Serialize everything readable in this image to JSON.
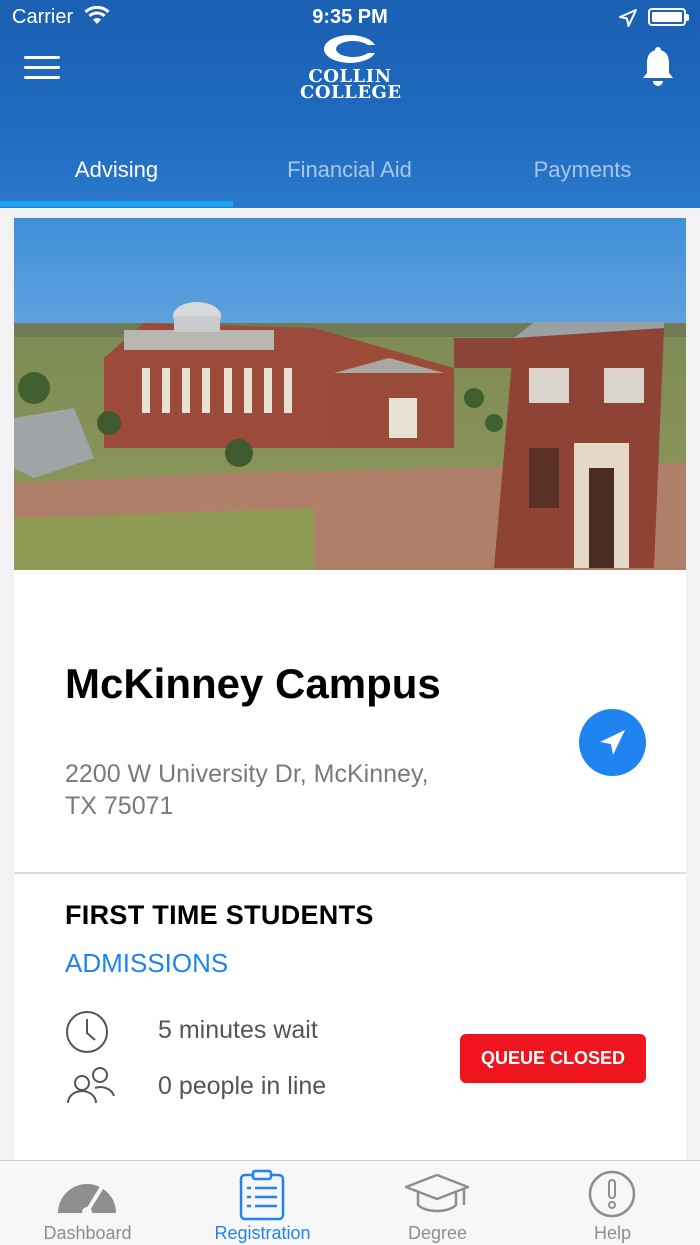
{
  "status_bar": {
    "carrier": "Carrier",
    "time": "9:35 PM"
  },
  "header": {
    "logo_line1": "COLLIN",
    "logo_line2": "COLLEGE",
    "tabs": [
      {
        "label": "Advising",
        "active": true
      },
      {
        "label": "Financial Aid",
        "active": false
      },
      {
        "label": "Payments",
        "active": false
      }
    ]
  },
  "campus": {
    "name": "McKinney Campus",
    "address_line1": "2200 W University Dr, McKinney,",
    "address_line2": "TX 75071"
  },
  "queue": {
    "title": "FIRST TIME STUDENTS",
    "link": "ADMISSIONS",
    "wait": "5 minutes wait",
    "people": "0 people in line",
    "button": "QUEUE CLOSED"
  },
  "tabbar": {
    "items": [
      {
        "label": "Dashboard",
        "icon": "dashboard-gauge-icon",
        "active": false
      },
      {
        "label": "Registration",
        "icon": "clipboard-list-icon",
        "active": true
      },
      {
        "label": "Degree",
        "icon": "graduation-cap-icon",
        "active": false
      },
      {
        "label": "Help",
        "icon": "exclamation-circle-icon",
        "active": false
      }
    ]
  },
  "colors": {
    "header_blue": "#1f6bc0",
    "tab_indicator": "#1ba4f2",
    "accent_blue": "#1f84ef",
    "queue_closed_red": "#f0141e"
  }
}
